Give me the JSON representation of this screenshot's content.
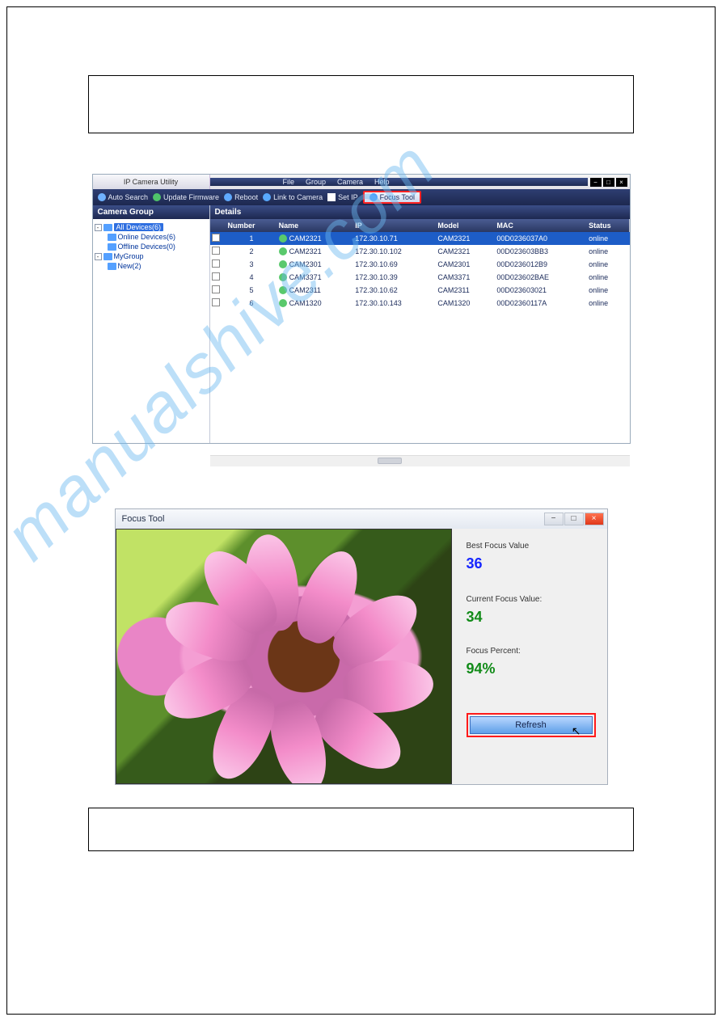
{
  "watermark": "manualshive.com",
  "utility": {
    "title": "IP Camera Utility",
    "menu": {
      "file": "File",
      "group": "Group",
      "camera": "Camera",
      "help": "Help"
    },
    "toolbar": {
      "auto_search": "Auto Search",
      "update_fw": "Update Firmware",
      "reboot": "Reboot",
      "link": "Link to Camera",
      "set_ip": "Set IP",
      "focus_tool": "Focus Tool"
    },
    "panels": {
      "camera_group": "Camera Group",
      "details": "Details"
    },
    "tree": {
      "root": "All Devices(6)",
      "online": "Online Devices(6)",
      "offline": "Offline Devices(0)",
      "mygroup": "MyGroup",
      "new2": "New(2)"
    },
    "table": {
      "headers": {
        "number": "Number",
        "name": "Name",
        "ip": "IP",
        "model": "Model",
        "mac": "MAC",
        "status": "Status"
      },
      "rows": [
        {
          "num": "1",
          "name": "CAM2321",
          "ip": "172.30.10.71",
          "model": "CAM2321",
          "mac": "00D0236037A0",
          "status": "online",
          "selected": true
        },
        {
          "num": "2",
          "name": "CAM2321",
          "ip": "172.30.10.102",
          "model": "CAM2321",
          "mac": "00D023603BB3",
          "status": "online"
        },
        {
          "num": "3",
          "name": "CAM2301",
          "ip": "172.30.10.69",
          "model": "CAM2301",
          "mac": "00D0236012B9",
          "status": "online"
        },
        {
          "num": "4",
          "name": "CAM3371",
          "ip": "172.30.10.39",
          "model": "CAM3371",
          "mac": "00D023602BAE",
          "status": "online"
        },
        {
          "num": "5",
          "name": "CAM2311",
          "ip": "172.30.10.62",
          "model": "CAM2311",
          "mac": "00D023603021",
          "status": "online"
        },
        {
          "num": "6",
          "name": "CAM1320",
          "ip": "172.30.10.143",
          "model": "CAM1320",
          "mac": "00D02360117A",
          "status": "online"
        }
      ]
    }
  },
  "focus": {
    "title": "Focus Tool",
    "best_label": "Best Focus Value",
    "best_value": "36",
    "current_label": "Current Focus Value:",
    "current_value": "34",
    "percent_label": "Focus Percent:",
    "percent_value": "94%",
    "refresh": "Refresh"
  }
}
